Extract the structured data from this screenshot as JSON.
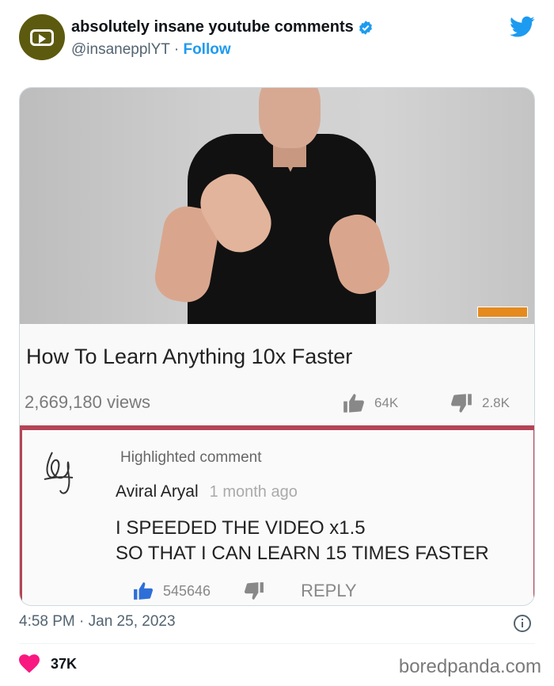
{
  "tweet": {
    "display_name": "absolutely insane youtube comments",
    "handle": "@insanepplYT",
    "separator": "·",
    "follow_label": "Follow",
    "timestamp": "4:58 PM · Jan 25, 2023",
    "like_count": "37K"
  },
  "video": {
    "title": "How To Learn Anything 10x Faster",
    "views": "2,669,180 views",
    "likes": "64K",
    "dislikes": "2.8K"
  },
  "comment": {
    "label": "Highlighted comment",
    "author": "Aviral Aryal",
    "time_ago": "1 month ago",
    "line1": "I SPEEDED THE VIDEO x1.5",
    "line2": "SO THAT I CAN LEARN 15 TIMES FASTER",
    "likes": "545646",
    "reply_label": "REPLY"
  },
  "watermark": "boredpanda.com",
  "colors": {
    "accent": "#1d9bf0",
    "heart": "#f91880",
    "highlight_border": "#b34556",
    "avatar_bg": "#5c5a0e"
  },
  "icons": [
    "verified-badge-icon",
    "twitter-bird-icon",
    "thumbs-up-icon",
    "thumbs-down-icon",
    "info-icon",
    "heart-icon"
  ]
}
